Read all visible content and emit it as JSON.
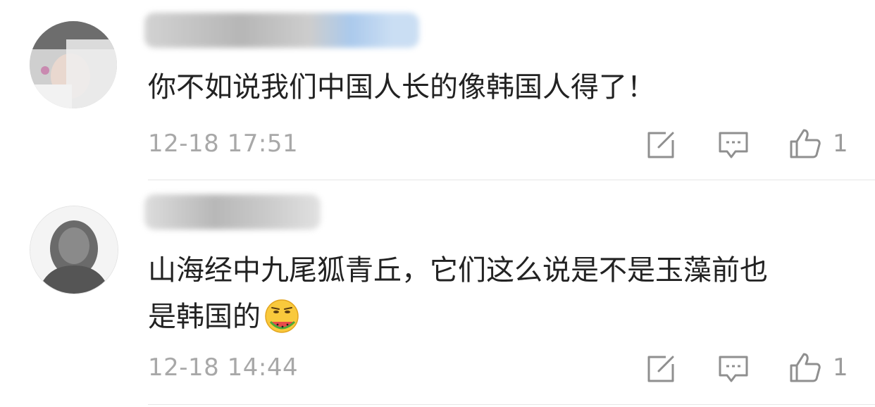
{
  "comments": [
    {
      "text": "你不如说我们中国人长的像韩国人得了！",
      "time": "12-18 17:51",
      "likes": "1"
    },
    {
      "text_line1": "山海经中九尾狐青丘，它们这么说是不是玉藻前也",
      "text_line2": "是韩国的",
      "time": "12-18 14:44",
      "likes": "1"
    }
  ],
  "icons": {
    "edit": "share-edit-icon",
    "reply": "comment-reply-icon",
    "like": "thumbs-up-icon",
    "emoji": "sweating-melon-emoji"
  },
  "colors": {
    "text": "#222222",
    "meta": "#a8a8a8",
    "icon": "#8f8f8f",
    "divider": "#e6e6e6"
  }
}
